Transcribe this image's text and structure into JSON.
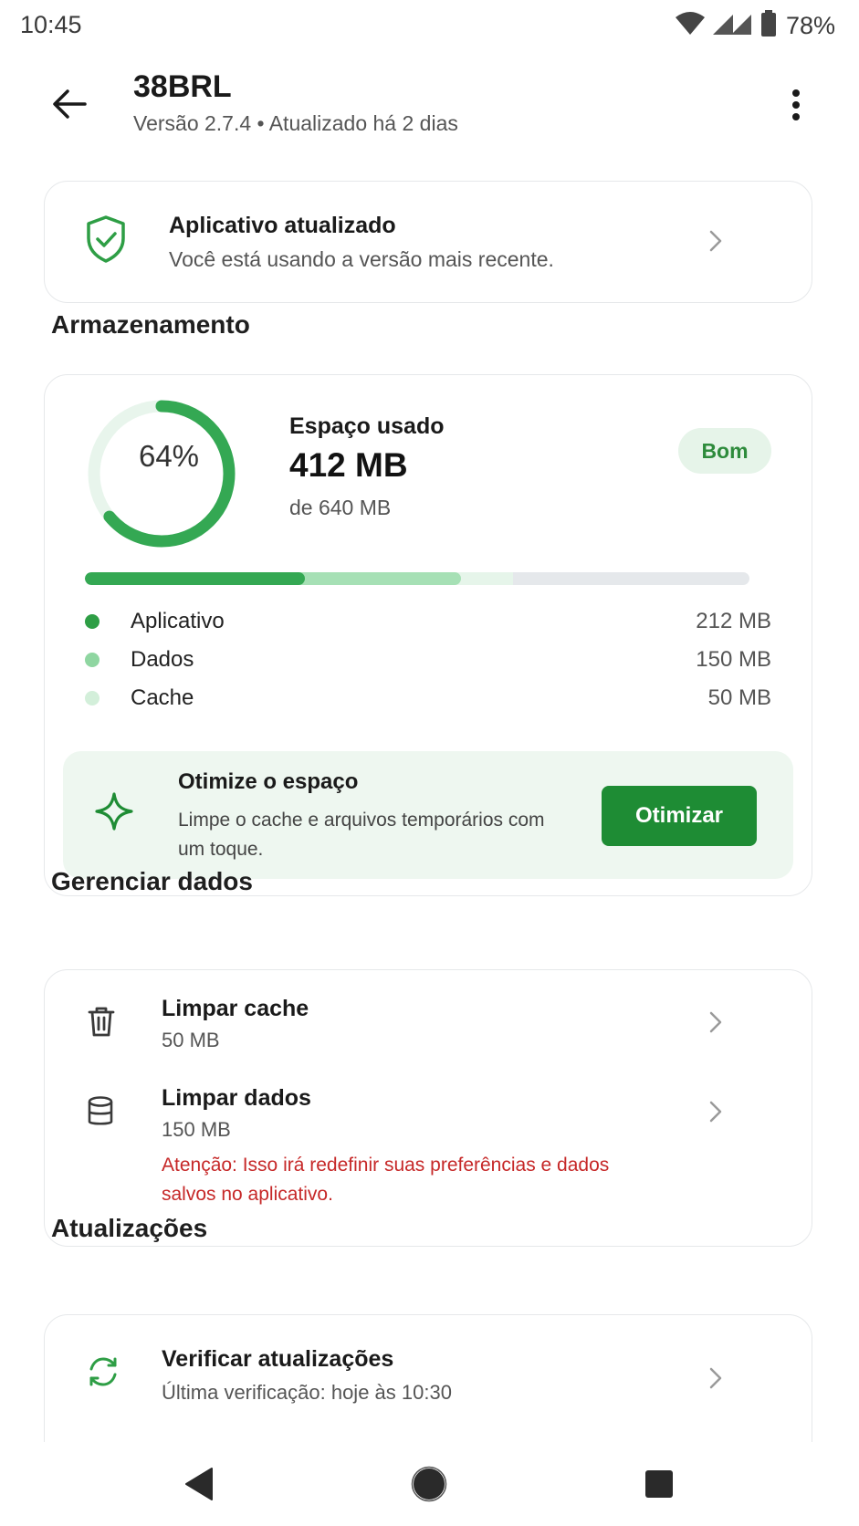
{
  "status_bar": {
    "time": "10:45",
    "battery_percent": "78%"
  },
  "header": {
    "title": "38BRL",
    "subtitle": "Versão 2.7.4 • Atualizado há 2 dias"
  },
  "update_card": {
    "title": "Aplicativo atualizado",
    "description": "Você está usando a versão mais recente."
  },
  "storage": {
    "section_title": "Armazenamento",
    "percent_label": "64%",
    "percent_used": 0.64,
    "space_label": "Espaço usado",
    "used": "412 MB",
    "total": "de 640 MB",
    "status_badge": "Bom",
    "breakdown": [
      {
        "label": "Aplicativo",
        "value": "212 MB",
        "mb": 212,
        "color": "#2e9e45"
      },
      {
        "label": "Dados",
        "value": "150 MB",
        "mb": 150,
        "color": "#8fd6a1"
      },
      {
        "label": "Cache",
        "value": "50 MB",
        "mb": 50,
        "color": "#d3efda"
      }
    ],
    "capacity_mb": 640,
    "optimize": {
      "title": "Otimize o espaço",
      "description": "Limpe o cache e arquivos temporários com um toque.",
      "button_label": "Otimizar"
    }
  },
  "manage": {
    "section_title": "Gerenciar dados",
    "items": [
      {
        "title": "Limpar cache",
        "subtitle": "50 MB",
        "icon": "trash-icon"
      },
      {
        "title": "Limpar dados",
        "subtitle": "150 MB",
        "icon": "database-icon",
        "warning": "Atenção: Isso irá redefinir suas preferências e dados salvos no aplicativo."
      }
    ]
  },
  "updates": {
    "section_title": "Atualizações",
    "items": [
      {
        "title": "Verificar atualizações",
        "subtitle": "Última verificação: hoje às 10:30",
        "icon": "refresh-icon"
      }
    ]
  },
  "colors": {
    "accent": "#1e8c34",
    "warning": "#c62828",
    "badge_bg": "#e6f4e9"
  },
  "icons": [
    "wifi-icon",
    "signal-icon",
    "battery-icon",
    "back-arrow-icon",
    "more-vert-icon",
    "shield-check-icon",
    "chevron-right-icon",
    "sparkle-icon",
    "trash-icon",
    "database-icon",
    "refresh-icon",
    "nav-back-icon",
    "nav-home-icon",
    "nav-recents-icon"
  ]
}
